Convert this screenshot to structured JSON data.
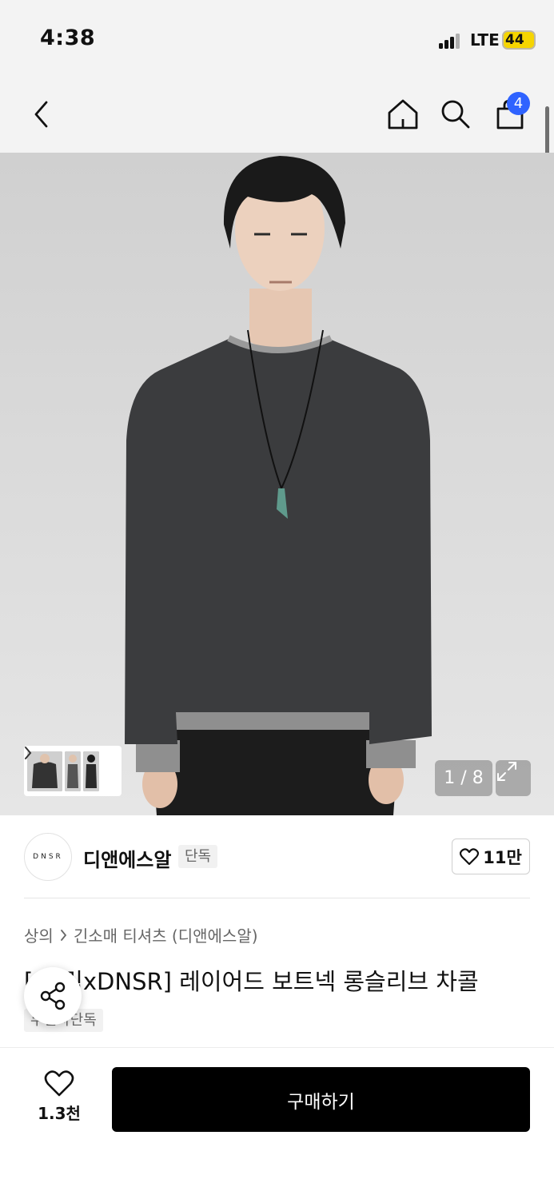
{
  "status_bar": {
    "time": "4:38",
    "network": "LTE",
    "battery": "44"
  },
  "nav": {
    "cart_count": "4"
  },
  "gallery": {
    "counter": "1 / 8"
  },
  "brand": {
    "logo_text": "DNSR",
    "name": "디앤에스알",
    "tag": "단독",
    "like_count": "11만"
  },
  "breadcrumb": {
    "category": "상의",
    "subcategory": "긴소매 티셔츠 (디앤에스알)"
  },
  "product": {
    "title": "[무프릭xDNSR] 레이어드 보트넥 롱슬리브 차콜",
    "title_visible": "[  프릭xDNSR] 레이어드 보트넥 롱슬리브 차콜",
    "promo_tag": "무신사단독"
  },
  "bottom_bar": {
    "wish_count": "1.3천",
    "buy_label": "구매하기"
  },
  "icons": [
    "back-icon",
    "home-icon",
    "search-icon",
    "cart-icon",
    "chevron-right-icon",
    "expand-icon",
    "heart-icon",
    "share-icon"
  ],
  "colors": {
    "badge": "#2f63ff",
    "buy_button": "#000000",
    "nav_background": "#f3f3f3",
    "battery": "#f6d500"
  }
}
